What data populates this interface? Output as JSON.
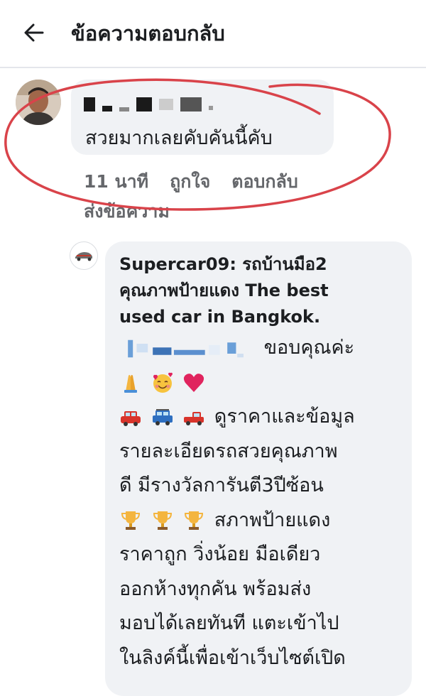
{
  "header": {
    "title": "ข้อความตอบกลับ",
    "back_icon": "arrow-left-icon"
  },
  "comment": {
    "text": "สวยมากเลยคับคันนี้คับ",
    "time": "11 นาที",
    "like_label": "ถูกใจ",
    "reply_label": "ตอบกลับ",
    "send_message_label": "ส่งข้อความ"
  },
  "reply": {
    "author_line1": "Supercar09: รถบ้านมือ2",
    "author_line2": "คุณภาพป้ายแดง The best",
    "author_line3": "used car in Bangkok.",
    "thanks": "ขอบคุณค่ะ",
    "body_line1": "ดูราคาและข้อมูล",
    "body_line2": "รายละเอียดรถสวยคุณภาพ",
    "body_line3": "ดี มีรางวัลการันตี3ปีซ้อน",
    "body_line4": "สภาพป้ายแดง",
    "body_line5": "ราคาถูก วิ่งน้อย มือเดียว",
    "body_line6": "ออกห้างทุกคัน พร้อมส่ง",
    "body_line7": "มอบได้เลยทันที แตะเข้าไป",
    "body_line8": "ในลิงค์นี้เพื่อเข้าเว็บไซต์เปิด"
  },
  "colors": {
    "annotation_red": "#d9434a",
    "bubble_bg": "#f0f2f5",
    "secondary_text": "#65676b"
  }
}
